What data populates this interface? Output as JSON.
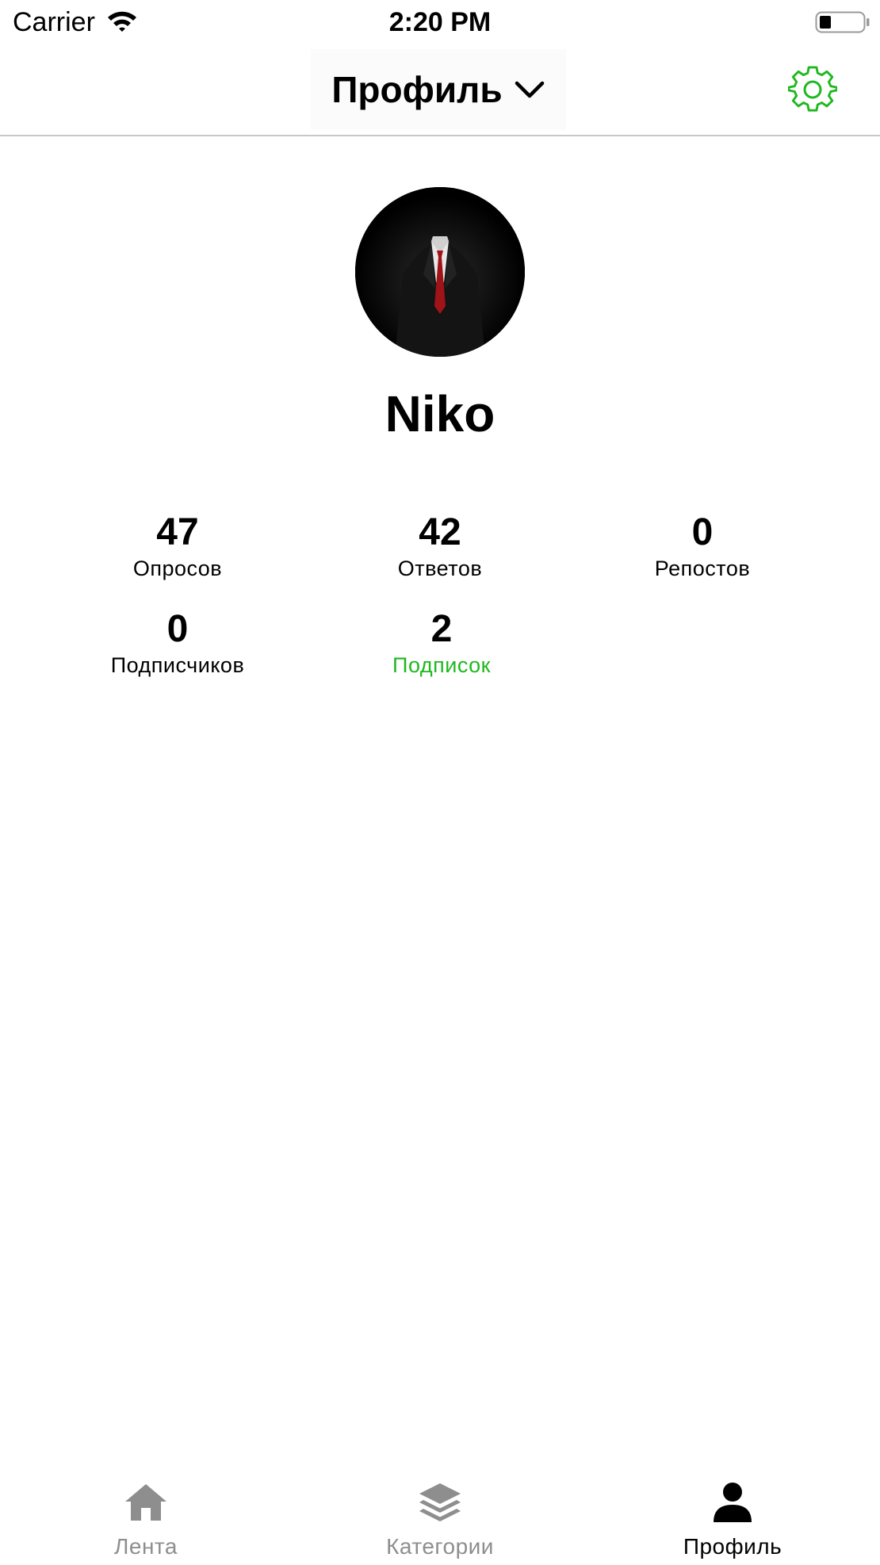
{
  "status_bar": {
    "carrier": "Carrier",
    "time": "2:20 PM"
  },
  "nav": {
    "title": "Профиль",
    "dropdown_icon": "chevron-down-icon",
    "settings_icon": "gear-icon"
  },
  "profile": {
    "name": "Niko",
    "avatar": "avatar-image"
  },
  "stats": [
    {
      "value": "47",
      "label": "Опросов"
    },
    {
      "value": "42",
      "label": "Ответов"
    },
    {
      "value": "0",
      "label": "Репостов"
    },
    {
      "value": "0",
      "label": "Подписчиков"
    },
    {
      "value": "2",
      "label": "Подписок"
    }
  ],
  "tab_bar": {
    "items": [
      {
        "label": "Лента",
        "icon": "home-icon",
        "active": false
      },
      {
        "label": "Категории",
        "icon": "layers-icon",
        "active": false
      },
      {
        "label": "Профиль",
        "icon": "person-icon",
        "active": true
      }
    ]
  },
  "colors": {
    "accent": "#1fb81f",
    "inactive_tab": "#8e8e8e",
    "active_tab": "#000000"
  }
}
